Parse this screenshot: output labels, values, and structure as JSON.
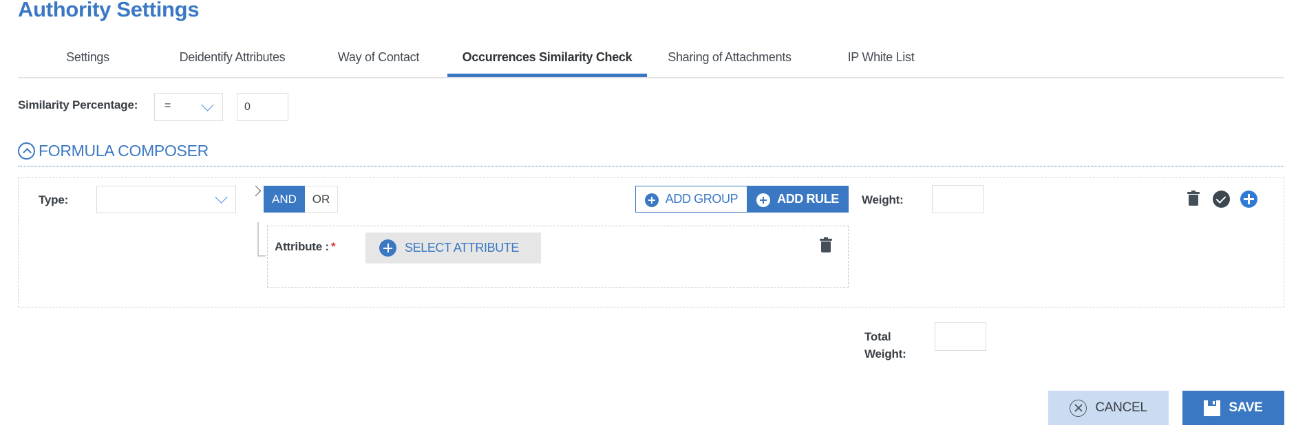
{
  "page": {
    "title": "Authority Settings"
  },
  "tabs": [
    {
      "label": "Settings",
      "active": false
    },
    {
      "label": "Deidentify Attributes",
      "active": false
    },
    {
      "label": "Way of Contact",
      "active": false
    },
    {
      "label": "Occurrences Similarity Check",
      "active": true
    },
    {
      "label": "Sharing of Attachments",
      "active": false
    },
    {
      "label": "IP White List",
      "active": false
    }
  ],
  "similarity": {
    "label": "Similarity Percentage:",
    "operator": "=",
    "value": "0"
  },
  "formula_composer": {
    "heading": "FORMULA COMPOSER",
    "type_label": "Type:",
    "type_value": "",
    "logic": {
      "and_label": "AND",
      "or_label": "OR",
      "selected": "AND"
    },
    "add_group_label": "ADD GROUP",
    "add_rule_label": "ADD RULE",
    "weight_label": "Weight:",
    "weight_value": "",
    "rule": {
      "attribute_label": "Attribute :",
      "required_mark": "*",
      "select_attribute_label": "SELECT ATTRIBUTE"
    },
    "total_weight_label_1": "Total",
    "total_weight_label_2": "Weight:",
    "total_weight_value": ""
  },
  "footer": {
    "cancel_label": "CANCEL",
    "save_label": "SAVE"
  },
  "colors": {
    "accent": "#3b78c3",
    "cancel_bg": "#cbdcf2",
    "icon_dark": "#454f58",
    "required": "#e03a3a"
  }
}
